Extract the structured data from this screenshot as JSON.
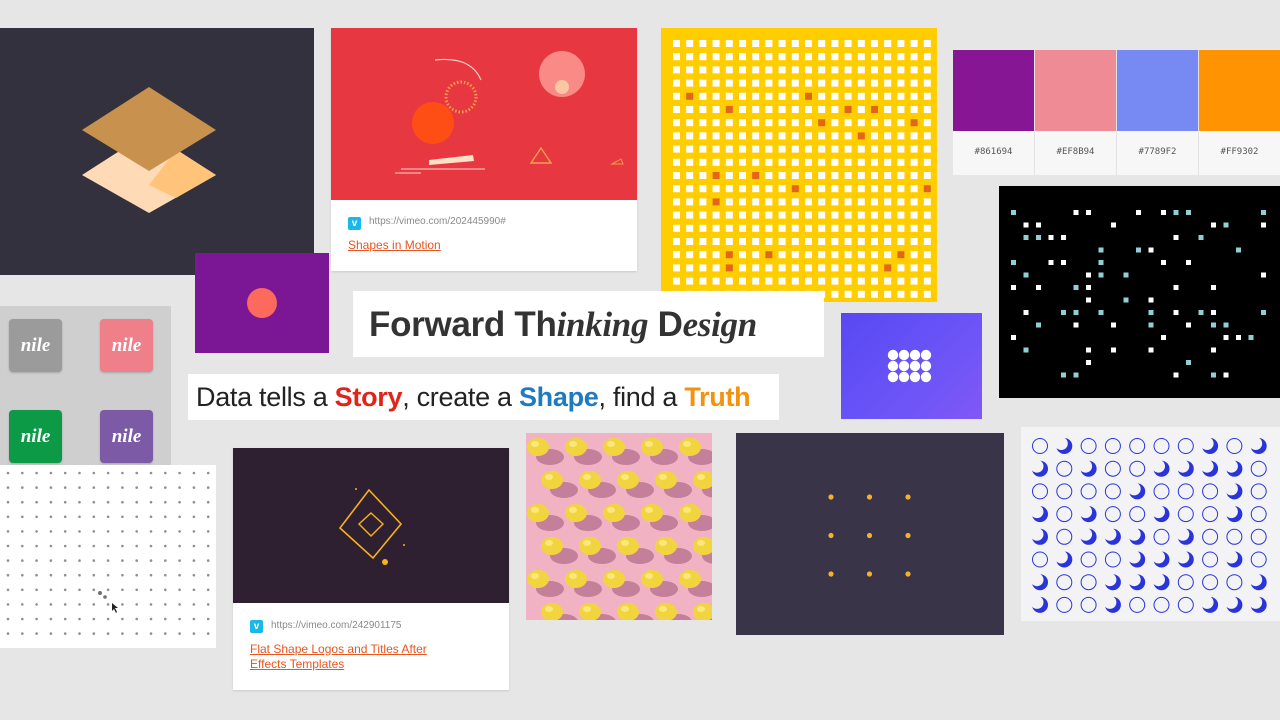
{
  "colors": {
    "background": "#e6e6e6",
    "link_accent": "#e8551f",
    "vimeo_blue": "#1ab7ea"
  },
  "cards": {
    "motion": {
      "badge": "v",
      "url": "https://vimeo.com/202445990#",
      "title": "Shapes in Motion"
    },
    "flat_logos": {
      "badge": "v",
      "url": "https://vimeo.com/242901175",
      "title": "Flat Shape Logos and Titles After Effects Templates"
    },
    "palette": [
      {
        "color": "#861694",
        "label": "#861694"
      },
      {
        "color": "#EF8B94",
        "label": "#EF8B94"
      },
      {
        "color": "#7789F2",
        "label": "#7789F2"
      },
      {
        "color": "#FF9302",
        "label": "#FF9302"
      }
    ],
    "nile": [
      {
        "label": "nile",
        "color": "#9b9b9b"
      },
      {
        "label": "nile",
        "color": "#ef7f88"
      },
      {
        "label": "nile",
        "color": "#0c9a47"
      },
      {
        "label": "nile",
        "color": "#7c5aa6"
      }
    ]
  },
  "headline": {
    "part1": "Forward Th",
    "part2": "inking",
    "part3": " D",
    "part4": "esign"
  },
  "tagline": {
    "t1": "Data tells a ",
    "w1": "Story",
    "t2": ", create a ",
    "w2": "Shape",
    "t3": ", find a ",
    "w3": "Truth",
    "color_story": "#e2231a",
    "color_shape": "#1e7bc2",
    "color_truth": "#f39210"
  }
}
